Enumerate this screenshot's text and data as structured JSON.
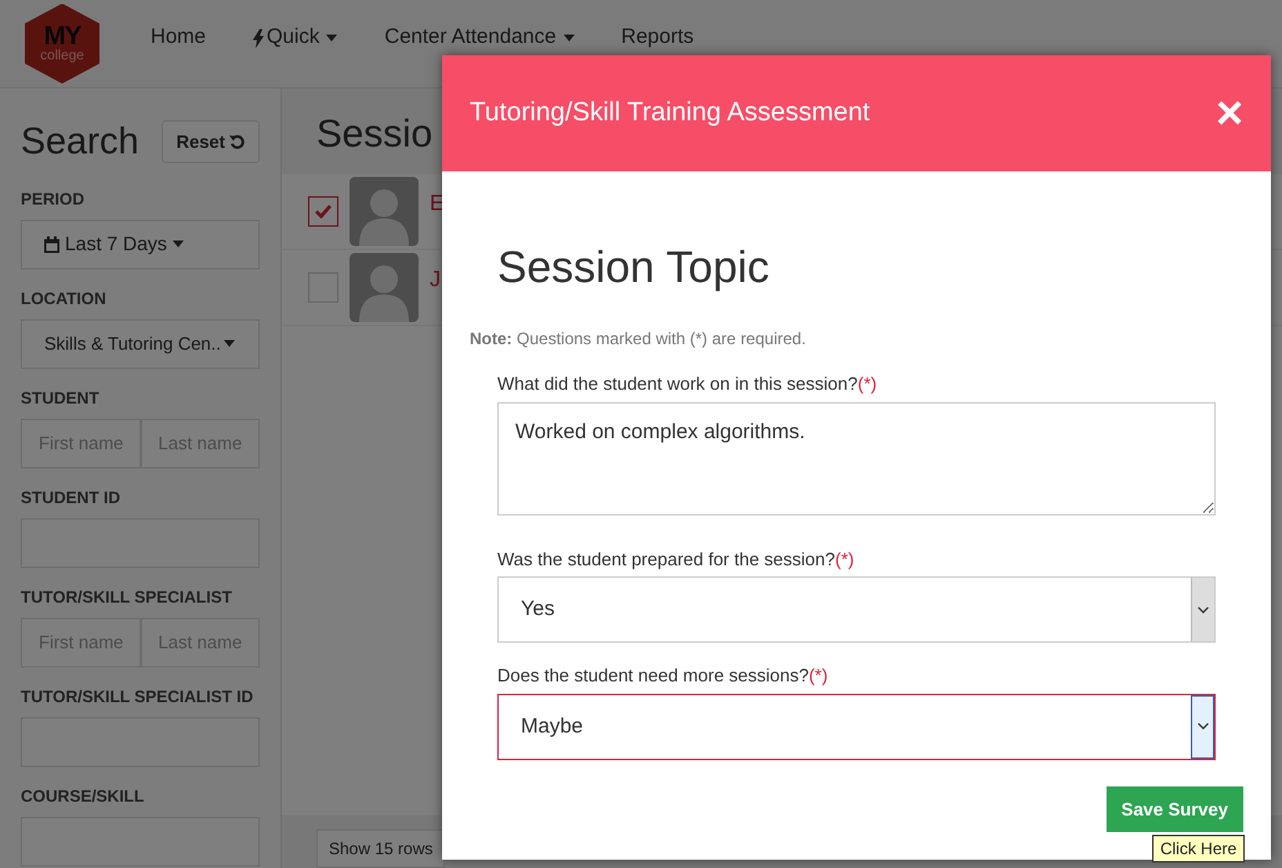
{
  "navbar": {
    "logo": {
      "main": "MY",
      "sub": "college"
    },
    "items": [
      {
        "label": "Home",
        "kind": "link",
        "dropdown": false
      },
      {
        "label": "Quick",
        "kind": "quick",
        "dropdown": true
      },
      {
        "label": "Center Attendance",
        "kind": "link",
        "dropdown": true
      },
      {
        "label": "Reports",
        "kind": "link",
        "dropdown": false
      }
    ]
  },
  "sidebar": {
    "title": "Search",
    "reset_button": "Reset",
    "filters": [
      {
        "label": "PERIOD",
        "kind": "dropdown",
        "value": "Last 7 Days"
      },
      {
        "label": "LOCATION",
        "kind": "select",
        "value": "Skills & Tutoring Cen.."
      },
      {
        "label": "STUDENT",
        "kind": "name",
        "placeholders": [
          "First name",
          "Last name"
        ]
      },
      {
        "label": "STUDENT ID",
        "kind": "text"
      },
      {
        "label": "TUTOR/SKILL SPECIALIST",
        "kind": "name",
        "placeholders": [
          "First name",
          "Last name"
        ]
      },
      {
        "label": "TUTOR/SKILL SPECIALIST ID",
        "kind": "text"
      },
      {
        "label": "COURSE/SKILL",
        "kind": "text"
      }
    ]
  },
  "main": {
    "title": "Sessio",
    "rows": [
      {
        "name": "E",
        "checked": true
      },
      {
        "name": "J",
        "checked": false
      }
    ],
    "footer_button": "Show 15 rows"
  },
  "modal": {
    "title": "Tutoring/Skill Training Assessment",
    "close": "×",
    "heading": "Session Topic",
    "note": "**Note:** Questions marked with (*) are required.",
    "questions": [
      {
        "kind": "textarea",
        "label": "What did the student work on in this session?",
        "required_mark": "(*)",
        "value": "Worked on complex algorithms.",
        "invalid": false,
        "focused": false
      },
      {
        "kind": "select",
        "label": "Was the student prepared for the session?",
        "required_mark": "(*)",
        "value": "Yes",
        "invalid": false,
        "focused": false
      },
      {
        "kind": "select",
        "label": "Does the student need more sessions?",
        "required_mark": "(*)",
        "value": "Maybe",
        "invalid": true,
        "focused": true
      }
    ],
    "save_button": "Save Survey",
    "tooltip": "Click Here"
  }
}
